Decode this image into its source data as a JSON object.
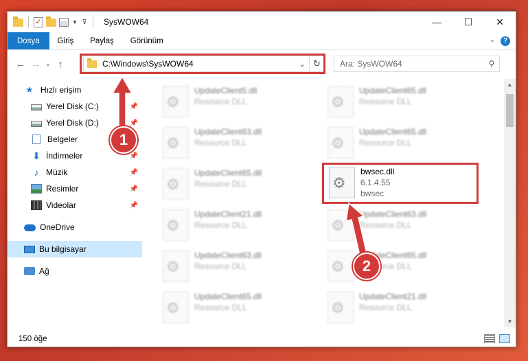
{
  "window": {
    "title": "SysWOW64",
    "controls": {
      "minimize": "—",
      "maximize": "☐",
      "close": "✕"
    }
  },
  "ribbon": {
    "tabs": [
      "Dosya",
      "Giriş",
      "Paylaş",
      "Görünüm"
    ],
    "help": "?"
  },
  "nav": {
    "back": "←",
    "forward": "→",
    "recent": "⌄",
    "up": "↑",
    "address": "C:\\Windows\\SysWOW64",
    "refresh": "↻",
    "search_placeholder": "Ara: SysWOW64",
    "search_icon": "⚲"
  },
  "sidebar": {
    "items": [
      {
        "label": "Hızlı erişim",
        "icon": "star-icon",
        "pinned": false
      },
      {
        "label": "Yerel Disk (C:)",
        "icon": "drive-icon",
        "pinned": true
      },
      {
        "label": "Yerel Disk (D:)",
        "icon": "drive-icon",
        "pinned": true
      },
      {
        "label": "Belgeler",
        "icon": "documents-icon",
        "pinned": true
      },
      {
        "label": "İndirmeler",
        "icon": "downloads-icon",
        "pinned": true
      },
      {
        "label": "Müzik",
        "icon": "music-icon",
        "pinned": true
      },
      {
        "label": "Resimler",
        "icon": "pictures-icon",
        "pinned": true
      },
      {
        "label": "Videolar",
        "icon": "videos-icon",
        "pinned": true
      },
      {
        "label": "OneDrive",
        "icon": "cloud-icon",
        "pinned": false
      },
      {
        "label": "Bu bilgisayar",
        "icon": "computer-icon",
        "pinned": false,
        "selected": true
      },
      {
        "label": "Ağ",
        "icon": "network-icon",
        "pinned": false
      }
    ]
  },
  "files": {
    "left_column": [
      {
        "name": "UpdateClient5.dll",
        "type": "Resource DLL"
      },
      {
        "name": "UpdateClient63.dll",
        "type": "Resource DLL"
      },
      {
        "name": "UpdateClient65.dll",
        "type": "Resource DLL"
      },
      {
        "name": "UpdateClient21.dll",
        "type": "Resource DLL"
      },
      {
        "name": "UpdateClient63.dll",
        "type": "Resource DLL"
      },
      {
        "name": "UpdateClient65.dll",
        "type": "Resource DLL"
      }
    ],
    "right_column": [
      {
        "name": "UpdateClient65.dll",
        "type": "Resource DLL"
      },
      {
        "name": "UpdateClient65.dll",
        "type": "Resource DLL"
      },
      {
        "name": "UpdateClient63.dll",
        "type": "Resource DLL"
      },
      {
        "name": "UpdateClient65.dll",
        "type": "Resource DLL"
      },
      {
        "name": "UpdateClient21.dll",
        "type": "Resource DLL"
      }
    ],
    "highlighted": {
      "name": "bwsec.dll",
      "version": "6.1.4.55",
      "description": "bwsec"
    }
  },
  "status": {
    "item_count": "150 öğe"
  },
  "annotations": {
    "badge_1": "1",
    "badge_2": "2",
    "accent_color": "#d23a3a"
  }
}
